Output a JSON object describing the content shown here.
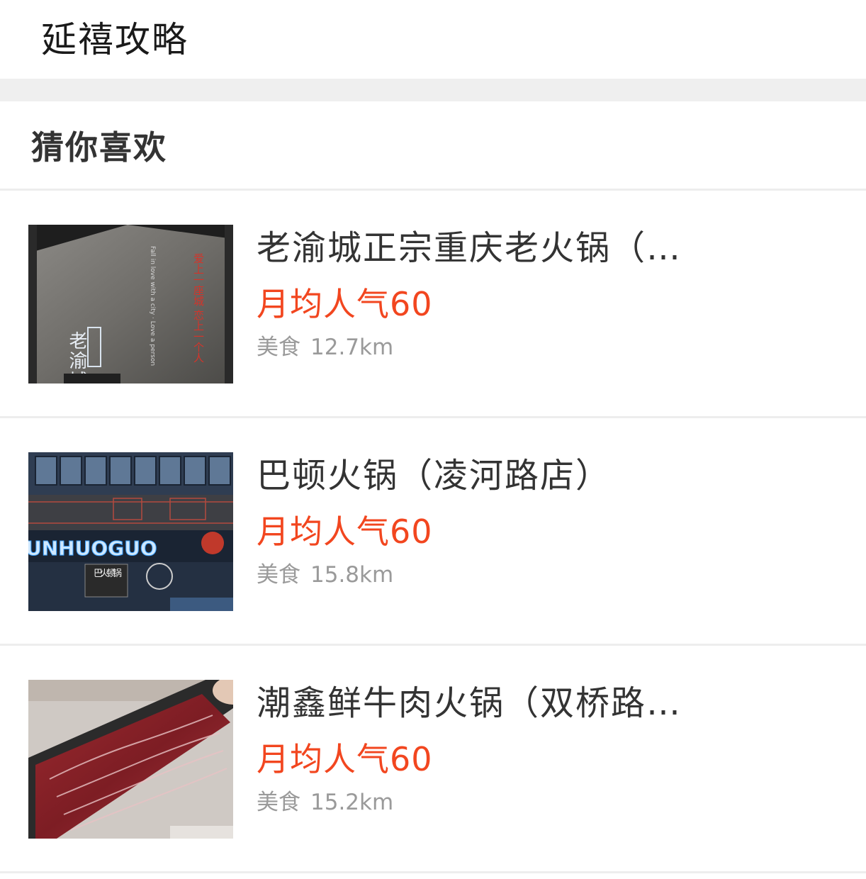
{
  "header": {
    "title": "延禧攻略"
  },
  "section": {
    "title": "猜你喜欢"
  },
  "items": [
    {
      "name": "老渝城正宗重庆老火锅（...",
      "popularity": "月均人气60",
      "category": "美食",
      "distance": "12.7km",
      "image_text": {
        "logo": "老渝城",
        "sign_red": "爱上一座城 恋上一个人",
        "sign_white": "Fall in love with a city · Love a person"
      }
    },
    {
      "name": "巴顿火锅（凌河路店）",
      "popularity": "月均人气60",
      "category": "美食",
      "distance": "15.8km",
      "image_text": {
        "neon": "UNHUOGUO",
        "plaque": "巴火 顿锅"
      }
    },
    {
      "name": "潮鑫鲜牛肉火锅（双桥路...",
      "popularity": "月均人气60",
      "category": "美食",
      "distance": "15.2km"
    }
  ],
  "colors": {
    "accent": "#f2461f",
    "divider": "#ededed",
    "gap": "#efefef"
  }
}
